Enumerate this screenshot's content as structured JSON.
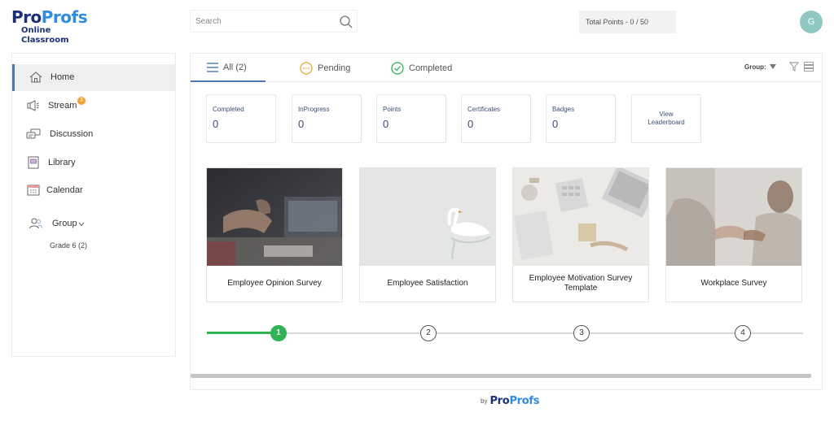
{
  "brand": {
    "logo_pro": "Pro",
    "logo_profs": "Profs",
    "logo_subtitle": "Online Classroom"
  },
  "header": {
    "search_placeholder": "Search",
    "total_points": "Total Points - 0 / 50",
    "avatar_initial": "G"
  },
  "sidebar": {
    "items": [
      {
        "label": "Home",
        "icon": "home-icon"
      },
      {
        "label": "Stream",
        "icon": "megaphone-icon",
        "badge": "3"
      },
      {
        "label": "Discussion",
        "icon": "chat-icon"
      },
      {
        "label": "Library",
        "icon": "book-icon"
      },
      {
        "label": "Calendar",
        "icon": "calendar-icon"
      }
    ],
    "group_label": "Group",
    "group_item": "Grade 6 (2)"
  },
  "tabs": {
    "all": "All (2)",
    "pending": "Pending",
    "completed": "Completed",
    "group_filter": "Group:"
  },
  "stats": [
    {
      "label": "Completed",
      "value": "0"
    },
    {
      "label": "InProgress",
      "value": "0"
    },
    {
      "label": "Points",
      "value": "0"
    },
    {
      "label": "Certificates",
      "value": "0"
    },
    {
      "label": "Badges",
      "value": "0"
    }
  ],
  "leaderboard": {
    "line1": "View",
    "line2": "Leaderboard"
  },
  "cards": [
    {
      "title": "Employee Opinion Survey"
    },
    {
      "title": "Employee Satisfaction"
    },
    {
      "title": "Employee Motivation Survey Template"
    },
    {
      "title": "Workplace Survey"
    }
  ],
  "pagination": {
    "pages": [
      "1",
      "2",
      "3",
      "4"
    ],
    "current": 1
  },
  "footer": {
    "by": "by",
    "logo_pro": "Pro",
    "logo_profs": "Profs"
  },
  "colors": {
    "accent": "#4a76b8",
    "progress": "#2db553",
    "badge": "#f0a030",
    "avatar": "#8fc7c3",
    "brand_dark": "#1a2f7a",
    "brand_light": "#2d8ce8"
  }
}
